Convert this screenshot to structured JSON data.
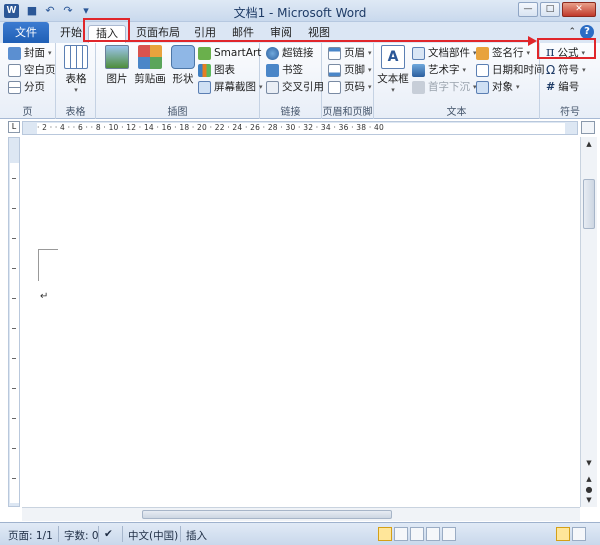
{
  "window": {
    "app_icon": "W",
    "title": "文档1 - Microsoft Word",
    "qat_icons": [
      "save-icon",
      "undo-icon",
      "redo-icon",
      "customize-icon"
    ]
  },
  "tabs": {
    "file": "文件",
    "items": [
      "开始",
      "插入",
      "页面布局",
      "引用",
      "邮件",
      "审阅",
      "视图"
    ],
    "active": "插入"
  },
  "ribbon": {
    "pages": {
      "label": "页",
      "buttons": [
        "封面",
        "空白页",
        "分页"
      ]
    },
    "tables": {
      "label": "表格",
      "button": "表格"
    },
    "illustrations": {
      "label": "插图",
      "picture": "图片",
      "clipart": "剪贴画",
      "shapes": "形状",
      "smartart": "SmartArt",
      "chart": "图表",
      "screenshot": "屏幕截图"
    },
    "links": {
      "label": "链接",
      "buttons": [
        "超链接",
        "书签",
        "交叉引用"
      ]
    },
    "header_footer": {
      "label": "页眉和页脚",
      "buttons": [
        "页眉",
        "页脚",
        "页码"
      ]
    },
    "text": {
      "label": "文本",
      "textbox": "文本框",
      "buttons": [
        "文档部件",
        "艺术字",
        "首字下沉",
        "签名行",
        "日期和时间",
        "对象"
      ]
    },
    "symbols": {
      "label": "符号",
      "buttons": [
        "公式",
        "符号",
        "编号"
      ],
      "pi": "π",
      "omega": "Ω",
      "hash": "#"
    }
  },
  "ruler": {
    "corner": "L",
    "numbers": "· 2 · · 4 · · 6 · · 8 · 10 · 12 · 14 · 16 · 18 · 20 · 22 · 24 · 26 · 28 · 30 · 32 · 34 · 36 · 38 · 40"
  },
  "document": {
    "paragraph_mark": "↵"
  },
  "statusbar": {
    "page": "页面: 1/1",
    "words": "字数: 0",
    "language": "中文(中国)",
    "mode": "插入"
  },
  "annotation_color": "#e0262b"
}
